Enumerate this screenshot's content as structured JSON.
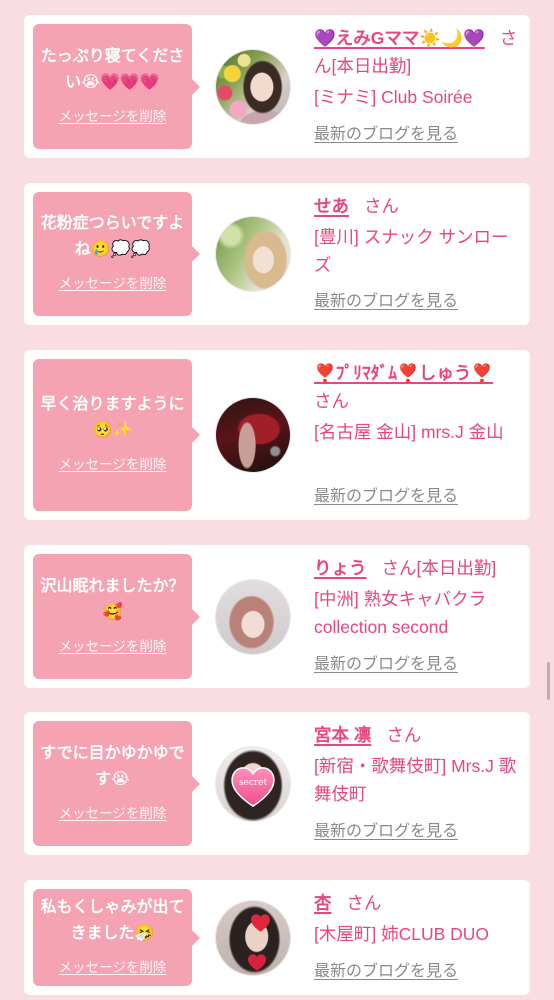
{
  "theme": {
    "page_background": "#fadde3",
    "card_background": "#ffffff",
    "bubble": "#f5a2b3",
    "accent_pink": "#e8467c",
    "muted_gray": "#8a8a8a"
  },
  "labels": {
    "honorific": "さん",
    "delete_message": "メッセージを削除",
    "latest_blog": "最新のブログを見る"
  },
  "messages": [
    {
      "text": "たっぷり寝てください😭💗💗💗",
      "name": "💜えみGママ☀️🌙💜",
      "status": "[本日出勤]",
      "shop": "[ミナミ] Club Soirée"
    },
    {
      "text": "花粉症つらいですよね🥲💭💭",
      "name": "せあ",
      "shop": "[豊川] スナック サンローズ"
    },
    {
      "text": "早く治りますように🥺✨",
      "name": "❣️ﾌﾟﾘﾏﾀﾞﾑ❣️しゅう❣️",
      "shop": "[名古屋 金山] mrs.J 金山"
    },
    {
      "text": "沢山眠れましたか？🥰",
      "name": "りょう",
      "status": "[本日出勤]",
      "shop": "[中洲] 熟女キャバクラ collection second"
    },
    {
      "text": "すでに目かゆかゆです😭",
      "name": "宮本 凛",
      "shop": "[新宿・歌舞伎町] Mrs.J 歌舞伎町",
      "avatar_sticker_text": "secret"
    },
    {
      "text": "私もくしゃみが出てきました🤧",
      "name": "杏",
      "shop": "[木屋町] 姉CLUB DUO"
    }
  ]
}
